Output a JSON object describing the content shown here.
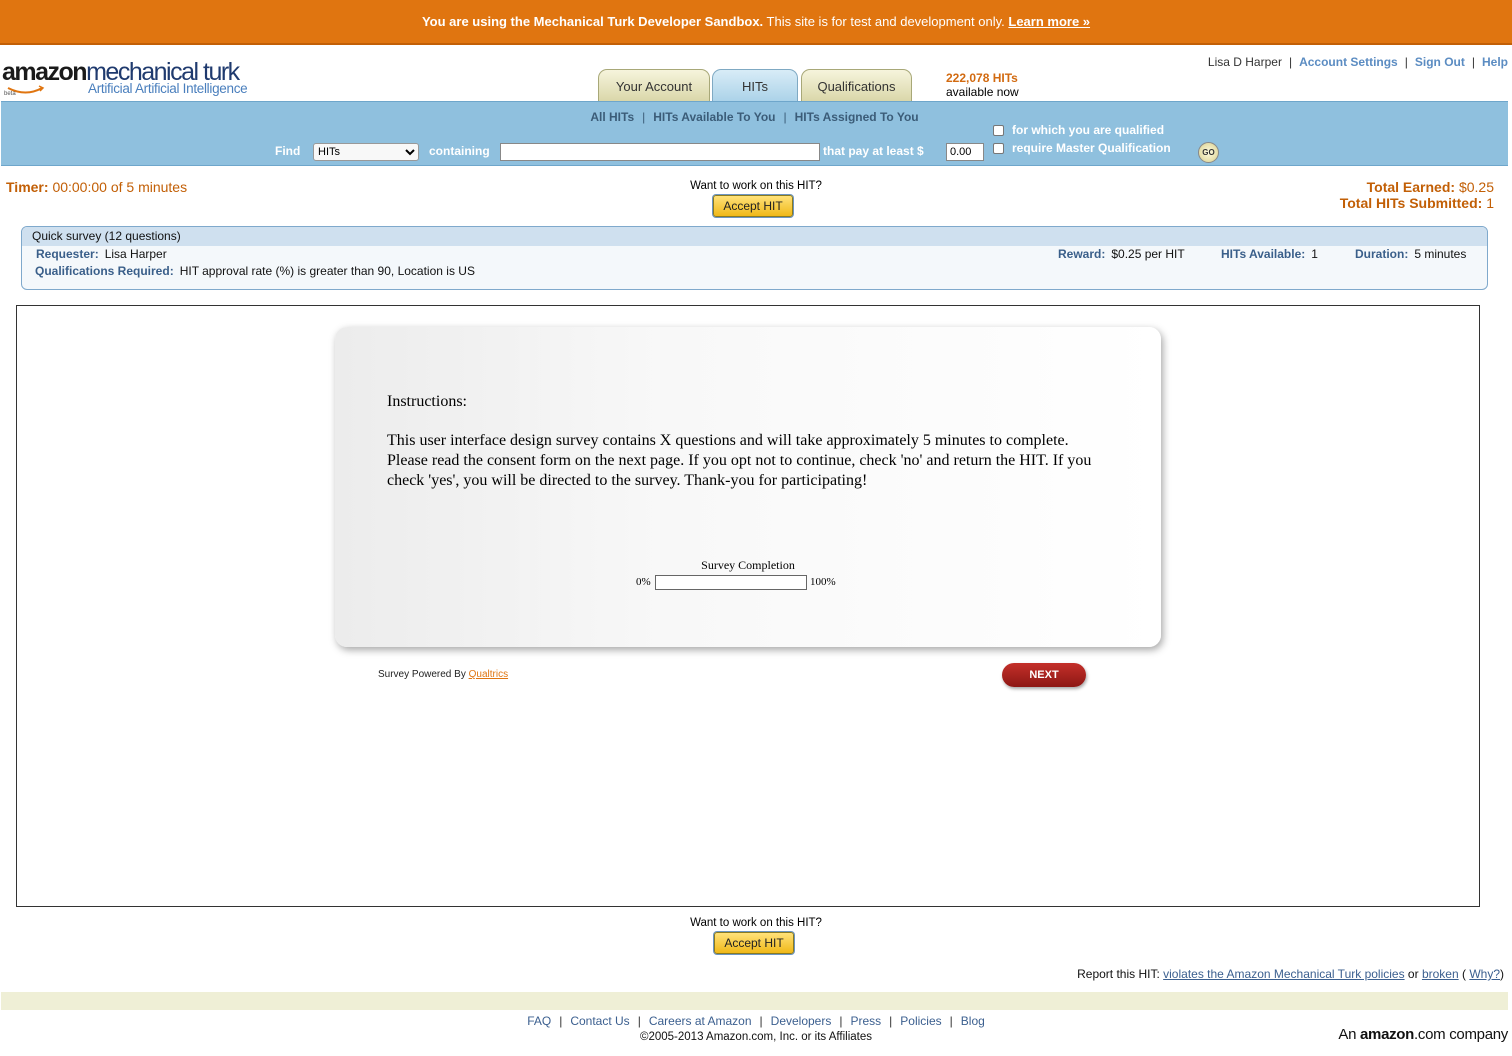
{
  "banner": {
    "bold_text": "You are using the Mechanical Turk Developer Sandbox.",
    "text": " This site is for test and development only. ",
    "link": "Learn more »"
  },
  "logo": {
    "amazon": "amazon",
    "mturk": "mechanical turk",
    "tagline": "Artificial Artificial Intelligence",
    "beta": "beta"
  },
  "tabs": [
    {
      "label": "Your Account"
    },
    {
      "label": "HITs"
    },
    {
      "label": "Qualifications"
    }
  ],
  "hit_count": {
    "number": "222,078 HITs",
    "text": "available now"
  },
  "user_links": {
    "name": "Lisa D Harper",
    "account": "Account Settings",
    "signout": "Sign Out",
    "help": "Help"
  },
  "subnav": {
    "all": "All HITs",
    "available": "HITs Available To You",
    "assigned": "HITs Assigned To You",
    "find": "Find",
    "find_value": "HITs",
    "containing": "containing",
    "pay": "that pay at least $",
    "pay_value": "0.00",
    "qualified": "for which you are qualified",
    "master": "require Master Qualification",
    "go": "GO"
  },
  "timer": {
    "label": "Timer:",
    "value": "00:00:00 of 5 minutes"
  },
  "accept": {
    "prompt": "Want to work on this HIT?",
    "button": "Accept HIT"
  },
  "earnings": {
    "earned_label": "Total Earned:",
    "earned_value": "$0.25",
    "submitted_label": "Total HITs Submitted:",
    "submitted_value": "1"
  },
  "hit": {
    "title": "Quick survey (12 questions)",
    "requester_label": "Requester:",
    "requester": "Lisa Harper",
    "qual_label": "Qualifications Required:",
    "qual": "HIT approval rate (%) is greater than 90, Location is US",
    "reward_label": "Reward:",
    "reward": "$0.25 per HIT",
    "avail_label": "HITs Available:",
    "avail": "1",
    "duration_label": "Duration:",
    "duration": "5 minutes"
  },
  "survey": {
    "instructions_label": "Instructions:",
    "instructions": "This user interface design survey contains X questions and will take approximately 5 minutes to complete. Please read the consent form on the next page. If you opt not to continue, check 'no' and return the HIT. If you check 'yes', you will be directed to the survey. Thank-you for participating!",
    "completion_label": "Survey Completion",
    "min": "0%",
    "max": "100%",
    "progress": 0,
    "powered": "Survey Powered By ",
    "powered_link": "Qualtrics",
    "next": "NEXT"
  },
  "report": {
    "label": "Report this HIT: ",
    "violates": "violates the Amazon Mechanical Turk policies",
    "or": " or ",
    "broken": "broken",
    "why_open": " ( ",
    "why": "Why?",
    "why_close": ")"
  },
  "footer": {
    "links": [
      "FAQ",
      "Contact Us",
      "Careers at Amazon",
      "Developers",
      "Press",
      "Policies",
      "Blog"
    ],
    "copyright": "©2005-2013 Amazon.com, Inc. or its Affiliates",
    "company_an": "An ",
    "company_amazon": "amazon",
    "company_com": ".com",
    "company_suffix": " company"
  },
  "colors": {
    "banner": "#e07510",
    "nav": "#8fc0de",
    "accent": "#c25f06",
    "next": "#a8201c"
  }
}
